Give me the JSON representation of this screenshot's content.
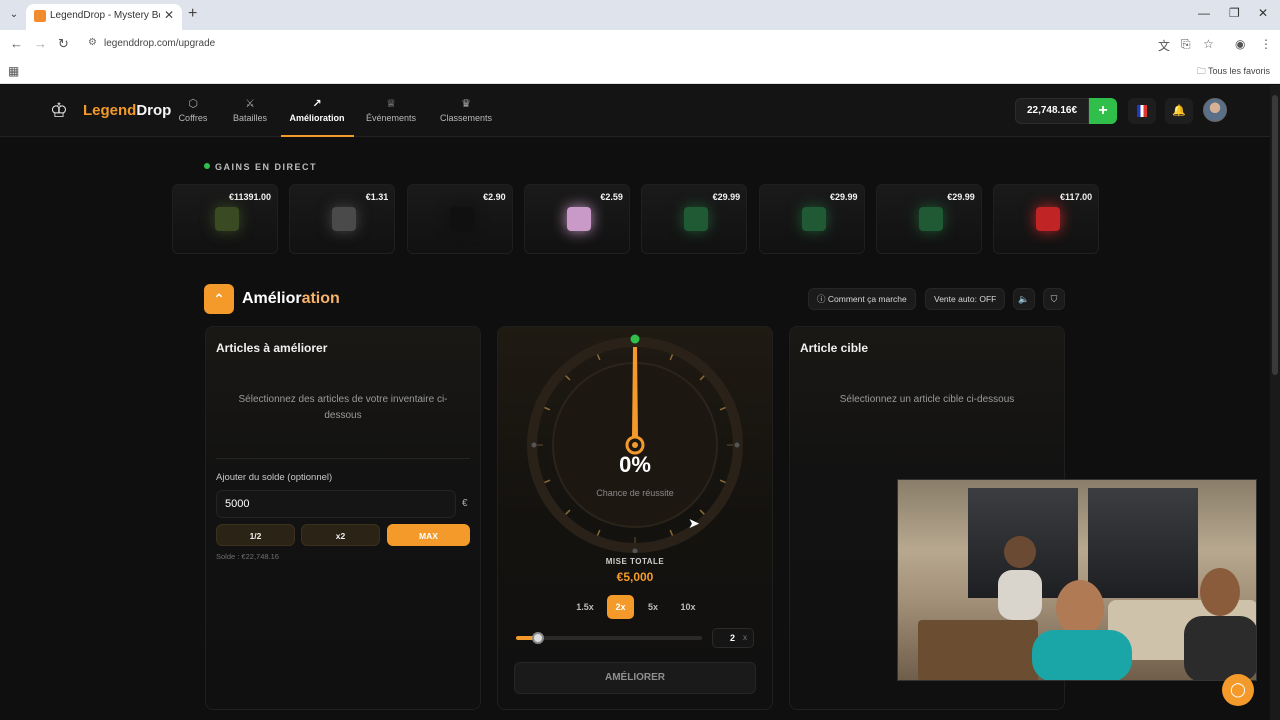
{
  "browser": {
    "tab_title": "LegendDrop - Mystery Boxes &",
    "url": "legenddrop.com/upgrade",
    "bookmarks_folder": "Tous les favoris"
  },
  "header": {
    "logo_part1": "Legend",
    "logo_part2": "Drop",
    "nav": [
      {
        "label": "Coffres",
        "icon": "box-icon"
      },
      {
        "label": "Batailles",
        "icon": "swords-icon"
      },
      {
        "label": "Amélioration",
        "icon": "trend-up-icon",
        "active": true
      },
      {
        "label": "Événements",
        "icon": "trophy-icon"
      },
      {
        "label": "Classements",
        "icon": "crown-icon"
      }
    ],
    "balance": "22,748.16€",
    "deposit_label": "+"
  },
  "live": {
    "title": "GAINS EN DIRECT",
    "drops": [
      {
        "price": "€11391.00",
        "color": "#3a4a22"
      },
      {
        "price": "€1.31",
        "color": "#4a4a4a"
      },
      {
        "price": "€2.90",
        "color": "#101010"
      },
      {
        "price": "€2.59",
        "color": "#c99ac7"
      },
      {
        "price": "€29.99",
        "color": "#1f5a34"
      },
      {
        "price": "€29.99",
        "color": "#1f5a34"
      },
      {
        "price": "€29.99",
        "color": "#1f5a34"
      },
      {
        "price": "€117.00",
        "color": "#c02424"
      }
    ]
  },
  "section": {
    "title_a": "Amélior",
    "title_b": "ation",
    "how_it_works": "Comment ça marche",
    "auto_sell": "Vente auto: OFF"
  },
  "left_panel": {
    "title": "Articles à améliorer",
    "hint": "Sélectionnez des articles de votre inventaire ci-dessous",
    "balance_label": "Ajouter du solde (optionnel)",
    "amount": "5000",
    "currency": "€",
    "half_label": "1/2",
    "double_label": "x2",
    "max_label": "MAX",
    "solde": "Solde : €22,748.16"
  },
  "center_panel": {
    "percent": "0%",
    "chance_label": "Chance de réussite",
    "mise_label": "MISE TOTALE",
    "mise_value": "€5,000",
    "multipliers": [
      "1.5x",
      "2x",
      "5x",
      "10x"
    ],
    "active_multiplier": "2x",
    "multiplier_value": "2",
    "multiplier_suffix": "x",
    "slider_level": 0.12,
    "upgrade_button": "AMÉLIORER"
  },
  "right_panel": {
    "title": "Article cible",
    "hint": "Sélectionnez un article cible ci-dessous"
  },
  "colors": {
    "accent": "#f39a2b",
    "success": "#2fbf4a",
    "background": "#0f0f10"
  }
}
